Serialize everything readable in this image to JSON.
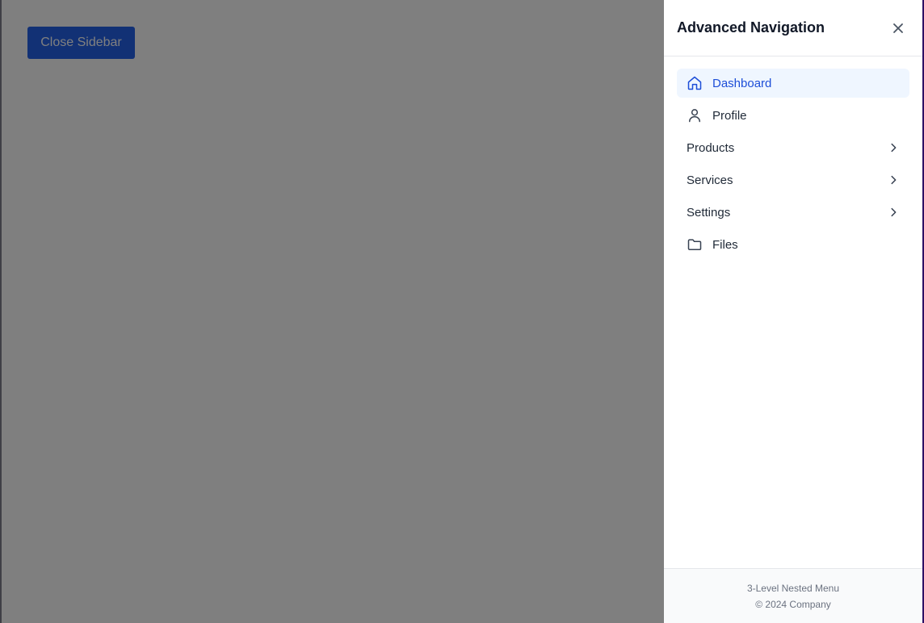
{
  "main": {
    "close_button_label": "Close Sidebar"
  },
  "sidebar": {
    "title": "Advanced Navigation",
    "close_icon": "close-icon",
    "items": [
      {
        "label": "Dashboard",
        "icon": "home-icon",
        "active": true,
        "has_submenu": false
      },
      {
        "label": "Profile",
        "icon": "user-icon",
        "active": false,
        "has_submenu": false
      },
      {
        "label": "Products",
        "icon": "",
        "active": false,
        "has_submenu": true
      },
      {
        "label": "Services",
        "icon": "",
        "active": false,
        "has_submenu": true
      },
      {
        "label": "Settings",
        "icon": "",
        "active": false,
        "has_submenu": true
      },
      {
        "label": "Files",
        "icon": "folder-icon",
        "active": false,
        "has_submenu": false
      }
    ],
    "footer": {
      "line1": "3-Level Nested Menu",
      "line2": "© 2024 Company"
    }
  },
  "colors": {
    "accent": "#2563eb",
    "active_bg": "#eff6ff",
    "active_text": "#1d4ed8",
    "overlay": "rgba(0,0,0,0.5)"
  }
}
